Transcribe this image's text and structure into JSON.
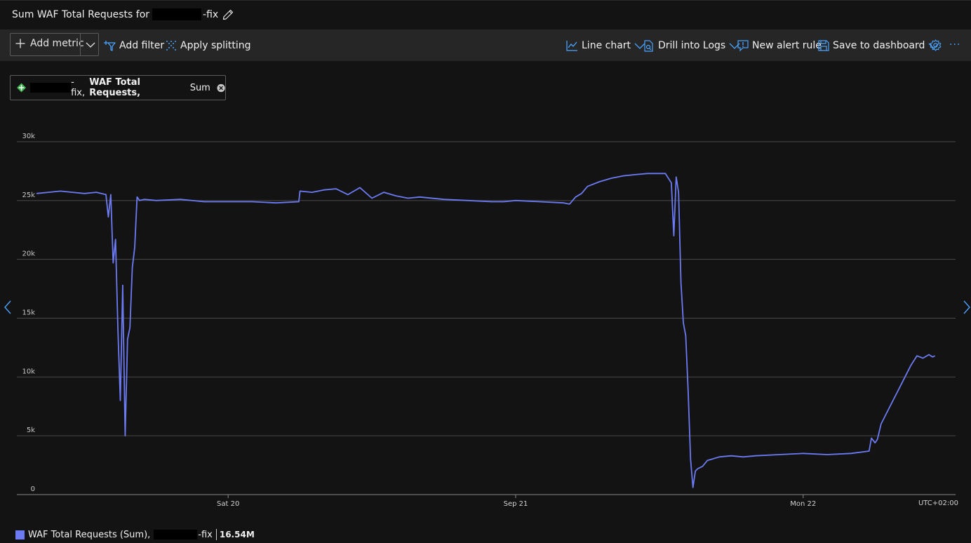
{
  "header": {
    "title_prefix": "Sum WAF Total Requests for",
    "title_suffix": "-fix"
  },
  "toolbar": {
    "add_metric": "Add metric",
    "add_filter": "Add filter",
    "apply_splitting": "Apply splitting",
    "line_chart": "Line chart",
    "drill_into_logs": "Drill into Logs",
    "new_alert_rule": "New alert rule",
    "save_to_dashboard": "Save to dashboard",
    "more": "···"
  },
  "metric_pill": {
    "resource_suffix": "-fix,",
    "metric": "WAF Total Requests,",
    "aggregation": "Sum"
  },
  "legend": {
    "series_label": "WAF Total Requests (Sum),",
    "resource_suffix": "-fix",
    "total": "16.54M"
  },
  "colors": {
    "series": "#6c7bf3",
    "grid": "#4a4a4a",
    "background": "#131313"
  },
  "chart_data": {
    "type": "line",
    "y_ticks": [
      "0",
      "5k",
      "10k",
      "15k",
      "20k",
      "25k",
      "30k"
    ],
    "ylim": [
      0,
      30000
    ],
    "x_ticks": [
      "Sat 20",
      "Sep 21",
      "Mon 22"
    ],
    "x_tick_hours": [
      12,
      36,
      60
    ],
    "xlim_hours": [
      -4.0,
      71.2
    ],
    "timezone": "UTC+02:00",
    "series": [
      {
        "name": "WAF Total Requests (Sum)",
        "x_hours": [
          -4.0,
          -3.0,
          -2.0,
          -1.0,
          0.0,
          1.0,
          1.8,
          2.0,
          2.2,
          2.4,
          2.6,
          2.8,
          3.0,
          3.2,
          3.4,
          3.6,
          3.8,
          4.0,
          4.2,
          4.4,
          4.6,
          5.0,
          6.0,
          8.0,
          10.0,
          12.0,
          14.0,
          16.0,
          17.9,
          18.0,
          19.0,
          20.0,
          21.0,
          22.0,
          23.0,
          24.0,
          25.0,
          26.0,
          27.0,
          28.0,
          30.0,
          32.0,
          34.0,
          35.0,
          36.0,
          38.0,
          40.0,
          40.5,
          41.0,
          41.5,
          42.0,
          43.0,
          44.0,
          45.0,
          46.0,
          47.0,
          48.5,
          49.0,
          49.2,
          49.4,
          49.6,
          49.8,
          50.0,
          50.2,
          50.4,
          50.6,
          50.8,
          51.0,
          51.2,
          51.6,
          52.0,
          53.0,
          54.0,
          55.0,
          56.0,
          58.0,
          60.0,
          62.0,
          64.0,
          65.5,
          65.7,
          66.0,
          66.2,
          66.5,
          67.0,
          67.5,
          68.0,
          68.5,
          69.0,
          69.5,
          70.0,
          70.5,
          70.8,
          71.0
        ],
        "values": [
          25600,
          25700,
          25800,
          25700,
          25600,
          25700,
          25500,
          23600,
          25500,
          19700,
          21700,
          14000,
          8000,
          17800,
          5000,
          13200,
          14200,
          19300,
          21000,
          25300,
          25000,
          25100,
          25000,
          25100,
          24900,
          24900,
          24900,
          24800,
          24900,
          25800,
          25700,
          25900,
          26000,
          25500,
          26100,
          25200,
          25700,
          25400,
          25200,
          25300,
          25100,
          25000,
          24900,
          24900,
          25000,
          24900,
          24800,
          24700,
          25300,
          25600,
          26200,
          26600,
          26900,
          27100,
          27200,
          27300,
          27300,
          26500,
          22000,
          27000,
          25700,
          18000,
          14600,
          13500,
          8700,
          3000,
          600,
          2000,
          2200,
          2400,
          2900,
          3200,
          3300,
          3200,
          3300,
          3400,
          3500,
          3400,
          3500,
          3700,
          4800,
          4400,
          4700,
          6000,
          7000,
          8000,
          9000,
          10000,
          11000,
          11800,
          11600,
          11900,
          11700,
          11800
        ]
      }
    ]
  }
}
